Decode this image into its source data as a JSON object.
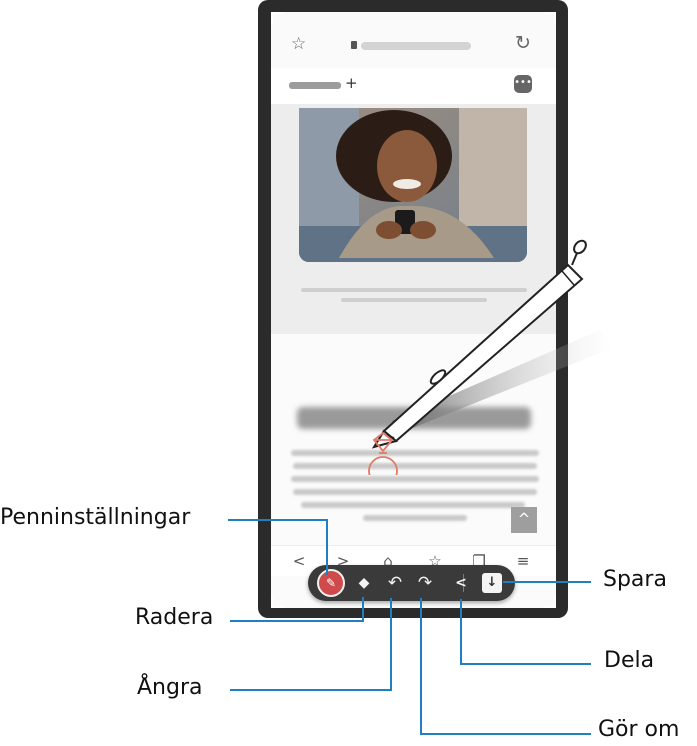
{
  "callouts": {
    "pen_settings": "Penninställningar",
    "eraser": "Radera",
    "undo": "Ångra",
    "redo": "Gör om",
    "save": "Spara",
    "share": "Dela"
  },
  "browser": {
    "star_icon": "☆",
    "reload_icon": "↻",
    "tab_add": "+",
    "chat_icon": "•••",
    "scroll_up_icon": "^"
  },
  "navbar": {
    "icons": [
      "<",
      ">",
      "⌂",
      "☆",
      "❐",
      "≡"
    ]
  },
  "toolbar": {
    "pen_icon": "✎",
    "eraser_icon": "◆",
    "undo_icon": "↶",
    "redo_icon": "↷",
    "share_icon": "<",
    "save_icon": "↓"
  },
  "colors": {
    "callout_line": "#1f7fc2",
    "toolbar": "#3a3a3a",
    "pen_accent": "#cf4b4b",
    "drawing": "#e07a6a"
  }
}
